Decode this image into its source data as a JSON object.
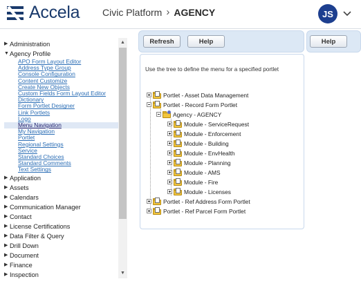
{
  "header": {
    "logo_text": "Accela",
    "product": "Civic Platform",
    "current": "AGENCY",
    "avatar_initials": "JS",
    "brand_color": "#1a3a6c",
    "avatar_color": "#1d3f8f"
  },
  "nav": {
    "items_top": [
      {
        "label": "Administration",
        "expanded": false
      },
      {
        "label": "Agency Profile",
        "expanded": true
      }
    ],
    "agency_profile_children": [
      "APO Form Layout Editor",
      "Address Type Group",
      "Console Configuration",
      "Content Customize",
      "Create New Objects",
      "Custom Fields Form Layout Editor",
      "Dictionary",
      "Form Portlet Designer",
      "Link Portlets",
      "Logo",
      "Menu Navigation",
      "My Navigation",
      "Portlet",
      "Regional Settings",
      "Service",
      "Standard Choices",
      "Standard Comments",
      "Text Settings"
    ],
    "selected_child": "Menu Navigation",
    "items_bottom": [
      "Application",
      "Assets",
      "Calendars",
      "Communication Manager",
      "Contact",
      "License Certifications",
      "Data Filter & Query",
      "Drill Down",
      "Document",
      "Finance",
      "Inspection"
    ]
  },
  "toolbar": {
    "refresh_label": "Refresh",
    "help_label": "Help",
    "help2_label": "Help"
  },
  "panel": {
    "instruction": "Use the tree to define the menu for a specified portlet"
  },
  "tree": {
    "portlets_top": [
      "Portlet - Asset Data Management",
      "Portlet - Record Form Portlet"
    ],
    "agency": "Agency - AGENCY",
    "modules": [
      "Module - ServiceRequest",
      "Module - Enforcement",
      "Module - Building",
      "Module - EnvHealth",
      "Module - Planning",
      "Module - AMS",
      "Module - Fire",
      "Module - Licenses"
    ],
    "portlets_bottom": [
      "Portlet - Ref Address Form Portlet",
      "Portlet - Ref Parcel Form Portlet"
    ]
  }
}
